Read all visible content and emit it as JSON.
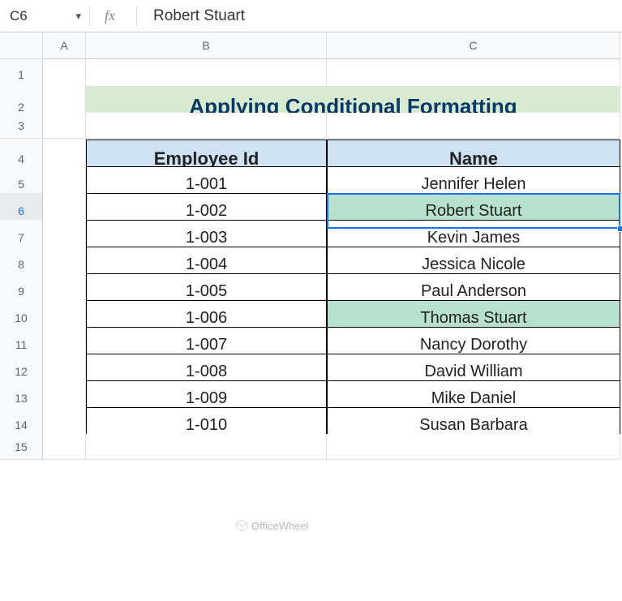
{
  "namebox": "C6",
  "formula": "Robert Stuart",
  "columns": [
    "A",
    "B",
    "C"
  ],
  "rows": [
    "1",
    "2",
    "3",
    "4",
    "5",
    "6",
    "7",
    "8",
    "9",
    "10",
    "11",
    "12",
    "13",
    "14",
    "15"
  ],
  "active_row": "6",
  "title": "Applying Conditional Formatting",
  "headers": {
    "id": "Employee Id",
    "name": "Name"
  },
  "data": [
    {
      "id": "1-001",
      "name": "Jennifer Helen",
      "hl": false
    },
    {
      "id": "1-002",
      "name": "Robert Stuart",
      "hl": true,
      "selected": true
    },
    {
      "id": "1-003",
      "name": "Kevin James",
      "hl": false
    },
    {
      "id": "1-004",
      "name": "Jessica Nicole",
      "hl": false
    },
    {
      "id": "1-005",
      "name": "Paul Anderson",
      "hl": false
    },
    {
      "id": "1-006",
      "name": "Thomas Stuart",
      "hl": true
    },
    {
      "id": "1-007",
      "name": "Nancy Dorothy",
      "hl": false
    },
    {
      "id": "1-008",
      "name": "David William",
      "hl": false
    },
    {
      "id": "1-009",
      "name": "Mike Daniel",
      "hl": false
    },
    {
      "id": "1-010",
      "name": "Susan Barbara",
      "hl": false
    }
  ],
  "watermark": "OfficeWheel"
}
